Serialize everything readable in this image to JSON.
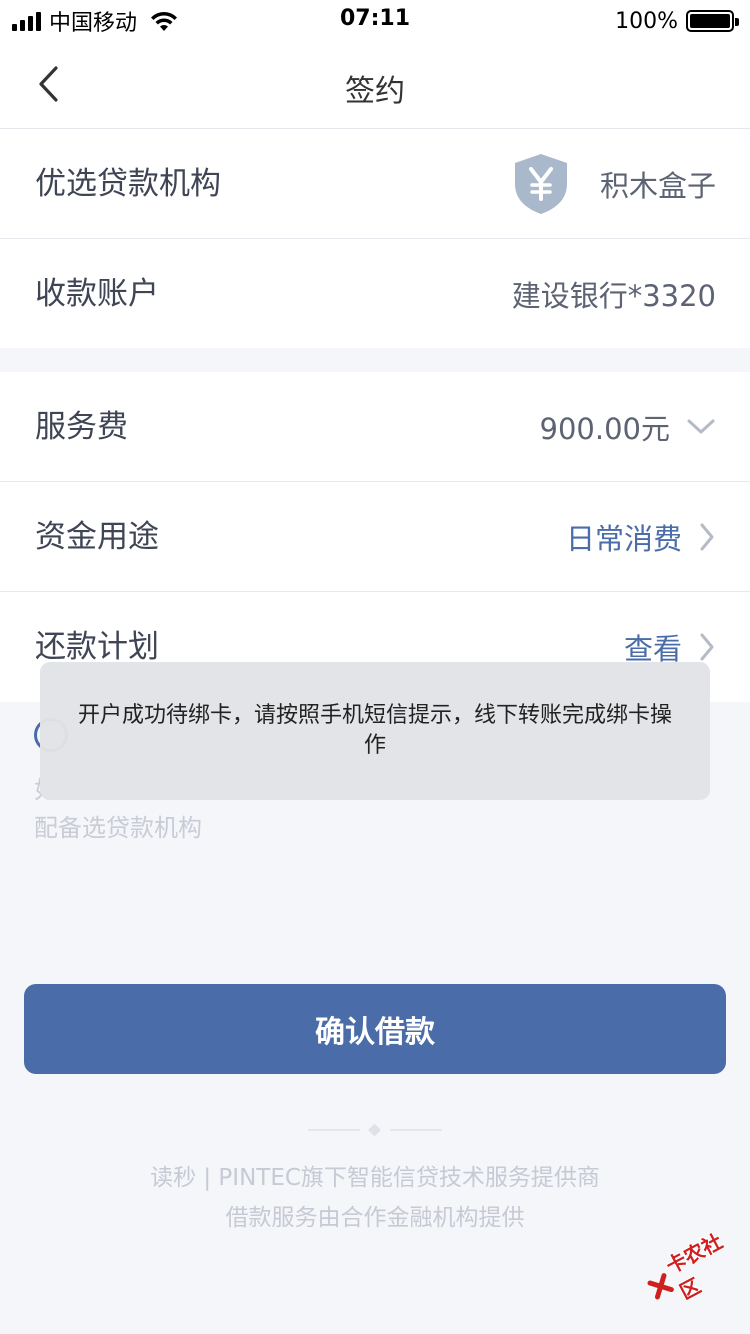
{
  "status_bar": {
    "carrier": "中国移动",
    "time": "07:11",
    "battery": "100%",
    "battery_level": 1.0
  },
  "nav": {
    "title": "签约",
    "back_icon": "chevron-left-icon"
  },
  "loan_info": {
    "lender_label": "优选贷款机构",
    "lender_name": "积木盒子",
    "lender_icon": "yuan-shield-icon",
    "account_label": "收款账户",
    "account_value": "建设银行*3320"
  },
  "loan_details": {
    "fee_label": "服务费",
    "fee_value": "900.00元",
    "purpose_label": "资金用途",
    "purpose_value": "日常消费",
    "plan_label": "还款计划",
    "plan_value": "查看"
  },
  "agreement": {
    "line1": "如",
    "line2": "配备选贷款机构"
  },
  "toast": {
    "message": "开户成功待绑卡，请按照手机短信提示，线下转账完成绑卡操作"
  },
  "confirm_button": {
    "label": "确认借款"
  },
  "footer": {
    "line1": "读秒 | PINTEC旗下智能信贷技术服务提供商",
    "line2": "借款服务由合作金融机构提供"
  },
  "watermark": {
    "text": "卡农社区"
  },
  "colors": {
    "accent": "#4a6ca8",
    "background": "#f5f6f9",
    "label_text": "#3f4555",
    "muted_text": "#c6cad4"
  }
}
